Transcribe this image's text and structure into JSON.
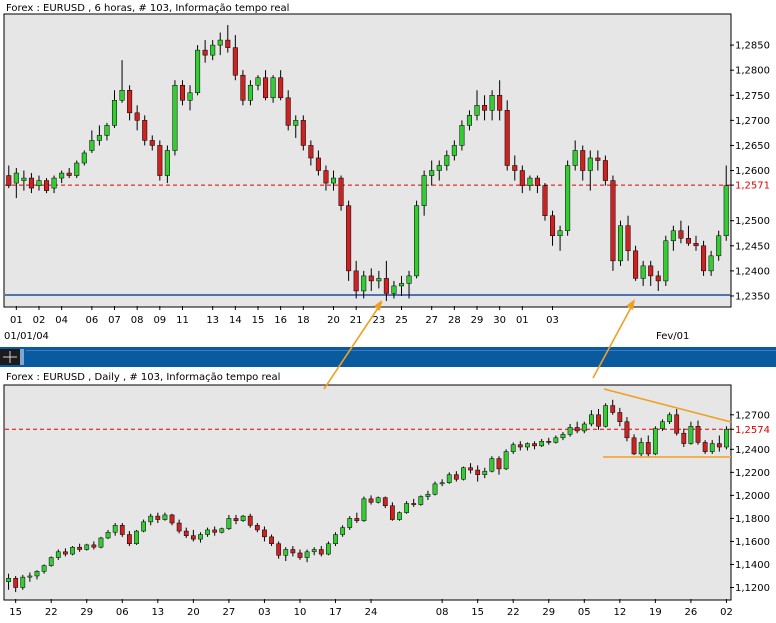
{
  "colors": {
    "panel_bg": "#e6e6e6",
    "up": "#33cc33",
    "down": "#cc2222",
    "wick": "#000000",
    "current_line": "#dd0000",
    "support_line": "#1f4e9e",
    "annotation": "#f0a020",
    "separator": "#0a5aa0"
  },
  "chart_data": [
    {
      "type": "candlestick",
      "title": "Forex : EURUSD , 6 horas, # 103, Informação tempo real",
      "y_ticks": [
        "1,2850",
        "1,2800",
        "1,2750",
        "1,2700",
        "1,2650",
        "1,2600",
        "1,2571",
        "1,2500",
        "1,2450",
        "1,2400",
        "1,2350"
      ],
      "current_price": 1.2571,
      "current_label": "1,2571",
      "ylim": [
        1.233,
        1.291
      ],
      "support_line": 1.2352,
      "x_ticks": [
        "01",
        "02",
        "04",
        "06",
        "07",
        "08",
        "09",
        "11",
        "13",
        "14",
        "15",
        "16",
        "18",
        "20",
        "21",
        "23",
        "25",
        "27",
        "28",
        "29",
        "30",
        "01",
        "03"
      ],
      "x_tick_positions": [
        1,
        4,
        7,
        11,
        14,
        17,
        20,
        23,
        27,
        30,
        33,
        36,
        39,
        43,
        46,
        49,
        52,
        56,
        59,
        62,
        65,
        68,
        72
      ],
      "x_date_left": "01/01/04",
      "x_date_right": "Fev/01",
      "candles": [
        [
          1.259,
          1.261,
          1.2565,
          1.257
        ],
        [
          1.2575,
          1.2605,
          1.2545,
          1.2595
        ],
        [
          1.258,
          1.26,
          1.256,
          1.2585
        ],
        [
          1.2585,
          1.2595,
          1.2555,
          1.2565
        ],
        [
          1.257,
          1.259,
          1.256,
          1.258
        ],
        [
          1.258,
          1.2585,
          1.2555,
          1.256
        ],
        [
          1.2565,
          1.259,
          1.2555,
          1.2585
        ],
        [
          1.2585,
          1.26,
          1.2575,
          1.2595
        ],
        [
          1.2595,
          1.2605,
          1.2585,
          1.259
        ],
        [
          1.259,
          1.262,
          1.2585,
          1.2615
        ],
        [
          1.2615,
          1.264,
          1.261,
          1.2635
        ],
        [
          1.264,
          1.268,
          1.2635,
          1.266
        ],
        [
          1.266,
          1.269,
          1.265,
          1.267
        ],
        [
          1.267,
          1.2695,
          1.266,
          1.269
        ],
        [
          1.269,
          1.276,
          1.2685,
          1.274
        ],
        [
          1.274,
          1.282,
          1.2735,
          1.276
        ],
        [
          1.276,
          1.277,
          1.27,
          1.2715
        ],
        [
          1.2715,
          1.273,
          1.268,
          1.27
        ],
        [
          1.27,
          1.271,
          1.265,
          1.266
        ],
        [
          1.266,
          1.267,
          1.264,
          1.265
        ],
        [
          1.265,
          1.266,
          1.258,
          1.259
        ],
        [
          1.259,
          1.265,
          1.2575,
          1.264
        ],
        [
          1.264,
          1.278,
          1.263,
          1.277
        ],
        [
          1.277,
          1.278,
          1.273,
          1.274
        ],
        [
          1.274,
          1.277,
          1.272,
          1.2755
        ],
        [
          1.2755,
          1.285,
          1.275,
          1.284
        ],
        [
          1.284,
          1.286,
          1.2815,
          1.283
        ],
        [
          1.283,
          1.286,
          1.282,
          1.285
        ],
        [
          1.285,
          1.2875,
          1.283,
          1.286
        ],
        [
          1.286,
          1.289,
          1.2835,
          1.2845
        ],
        [
          1.2845,
          1.287,
          1.278,
          1.279
        ],
        [
          1.279,
          1.28,
          1.273,
          1.274
        ],
        [
          1.274,
          1.278,
          1.273,
          1.277
        ],
        [
          1.277,
          1.279,
          1.276,
          1.2785
        ],
        [
          1.2785,
          1.28,
          1.274,
          1.2745
        ],
        [
          1.2745,
          1.279,
          1.2735,
          1.2785
        ],
        [
          1.2785,
          1.28,
          1.274,
          1.2745
        ],
        [
          1.2745,
          1.276,
          1.268,
          1.269
        ],
        [
          1.269,
          1.271,
          1.2665,
          1.27
        ],
        [
          1.27,
          1.271,
          1.264,
          1.265
        ],
        [
          1.265,
          1.266,
          1.261,
          1.2625
        ],
        [
          1.2625,
          1.264,
          1.259,
          1.26
        ],
        [
          1.26,
          1.261,
          1.256,
          1.2575
        ],
        [
          1.2575,
          1.26,
          1.256,
          1.2585
        ],
        [
          1.2585,
          1.259,
          1.252,
          1.253
        ],
        [
          1.253,
          1.254,
          1.238,
          1.24
        ],
        [
          1.24,
          1.242,
          1.2345,
          1.236
        ],
        [
          1.236,
          1.24,
          1.2345,
          1.239
        ],
        [
          1.239,
          1.2405,
          1.236,
          1.238
        ],
        [
          1.238,
          1.24,
          1.2365,
          1.2385
        ],
        [
          1.2385,
          1.242,
          1.234,
          1.2355
        ],
        [
          1.2355,
          1.238,
          1.2345,
          1.237
        ],
        [
          1.237,
          1.239,
          1.235,
          1.2375
        ],
        [
          1.2375,
          1.24,
          1.2345,
          1.239
        ],
        [
          1.239,
          1.254,
          1.2385,
          1.253
        ],
        [
          1.253,
          1.26,
          1.251,
          1.259
        ],
        [
          1.259,
          1.262,
          1.257,
          1.26
        ],
        [
          1.26,
          1.262,
          1.258,
          1.261
        ],
        [
          1.261,
          1.264,
          1.26,
          1.263
        ],
        [
          1.263,
          1.266,
          1.262,
          1.265
        ],
        [
          1.265,
          1.27,
          1.264,
          1.269
        ],
        [
          1.269,
          1.272,
          1.268,
          1.271
        ],
        [
          1.271,
          1.276,
          1.27,
          1.273
        ],
        [
          1.273,
          1.275,
          1.27,
          1.272
        ],
        [
          1.272,
          1.276,
          1.27,
          1.275
        ],
        [
          1.275,
          1.278,
          1.27,
          1.272
        ],
        [
          1.272,
          1.274,
          1.26,
          1.261
        ],
        [
          1.261,
          1.263,
          1.258,
          1.26
        ],
        [
          1.26,
          1.261,
          1.2555,
          1.257
        ],
        [
          1.257,
          1.259,
          1.256,
          1.2585
        ],
        [
          1.2585,
          1.259,
          1.2555,
          1.257
        ],
        [
          1.257,
          1.2575,
          1.25,
          1.251
        ],
        [
          1.251,
          1.252,
          1.245,
          1.247
        ],
        [
          1.247,
          1.249,
          1.244,
          1.248
        ],
        [
          1.248,
          1.262,
          1.247,
          1.261
        ],
        [
          1.261,
          1.266,
          1.26,
          1.264
        ],
        [
          1.264,
          1.265,
          1.258,
          1.26
        ],
        [
          1.26,
          1.264,
          1.256,
          1.2625
        ],
        [
          1.2625,
          1.264,
          1.26,
          1.262
        ],
        [
          1.262,
          1.263,
          1.257,
          1.258
        ],
        [
          1.258,
          1.259,
          1.24,
          1.242
        ],
        [
          1.242,
          1.25,
          1.241,
          1.249
        ],
        [
          1.249,
          1.251,
          1.242,
          1.244
        ],
        [
          1.244,
          1.245,
          1.238,
          1.2385
        ],
        [
          1.2385,
          1.242,
          1.237,
          1.241
        ],
        [
          1.241,
          1.242,
          1.237,
          1.239
        ],
        [
          1.239,
          1.24,
          1.236,
          1.238
        ],
        [
          1.238,
          1.247,
          1.237,
          1.246
        ],
        [
          1.246,
          1.249,
          1.244,
          1.248
        ],
        [
          1.248,
          1.25,
          1.2455,
          1.2465
        ],
        [
          1.2465,
          1.249,
          1.245,
          1.2455
        ],
        [
          1.2455,
          1.247,
          1.244,
          1.245
        ],
        [
          1.245,
          1.246,
          1.239,
          1.24
        ],
        [
          1.24,
          1.244,
          1.239,
          1.243
        ],
        [
          1.243,
          1.248,
          1.242,
          1.247
        ],
        [
          1.247,
          1.261,
          1.246,
          1.257
        ]
      ]
    },
    {
      "type": "candlestick",
      "title": "Forex : EURUSD , Daily , # 103, Informação tempo real",
      "y_ticks": [
        "1,2700",
        "1,2574",
        "1,2400",
        "1,2200",
        "1,2000",
        "1,1800",
        "1,1600",
        "1,1400",
        "1,1200"
      ],
      "current_price": 1.2574,
      "current_label": "1,2574",
      "ylim": [
        1.11,
        1.295
      ],
      "x_ticks": [
        "15",
        "22",
        "29",
        "06",
        "13",
        "20",
        "27",
        "03",
        "10",
        "17",
        "24",
        "08",
        "15",
        "22",
        "29",
        "05",
        "12",
        "19",
        "26",
        "02"
      ],
      "x_tick_positions": [
        1,
        6,
        11,
        16,
        21,
        26,
        31,
        36,
        41,
        46,
        51,
        61,
        66,
        71,
        76,
        81,
        86,
        91,
        96,
        101
      ],
      "candles": [
        [
          1.125,
          1.132,
          1.118,
          1.128
        ],
        [
          1.128,
          1.13,
          1.116,
          1.12
        ],
        [
          1.12,
          1.131,
          1.118,
          1.129
        ],
        [
          1.129,
          1.133,
          1.125,
          1.13
        ],
        [
          1.13,
          1.135,
          1.127,
          1.134
        ],
        [
          1.134,
          1.14,
          1.132,
          1.139
        ],
        [
          1.139,
          1.147,
          1.138,
          1.146
        ],
        [
          1.146,
          1.153,
          1.144,
          1.151
        ],
        [
          1.151,
          1.154,
          1.147,
          1.149
        ],
        [
          1.149,
          1.156,
          1.148,
          1.155
        ],
        [
          1.155,
          1.158,
          1.151,
          1.153
        ],
        [
          1.153,
          1.158,
          1.152,
          1.157
        ],
        [
          1.157,
          1.16,
          1.153,
          1.155
        ],
        [
          1.155,
          1.164,
          1.154,
          1.163
        ],
        [
          1.163,
          1.17,
          1.162,
          1.168
        ],
        [
          1.168,
          1.176,
          1.165,
          1.174
        ],
        [
          1.174,
          1.176,
          1.164,
          1.166
        ],
        [
          1.166,
          1.169,
          1.156,
          1.158
        ],
        [
          1.158,
          1.17,
          1.157,
          1.169
        ],
        [
          1.169,
          1.179,
          1.168,
          1.177
        ],
        [
          1.177,
          1.184,
          1.174,
          1.182
        ],
        [
          1.182,
          1.185,
          1.176,
          1.179
        ],
        [
          1.179,
          1.185,
          1.178,
          1.183
        ],
        [
          1.183,
          1.184,
          1.174,
          1.176
        ],
        [
          1.176,
          1.179,
          1.167,
          1.169
        ],
        [
          1.169,
          1.172,
          1.163,
          1.165
        ],
        [
          1.165,
          1.17,
          1.16,
          1.162
        ],
        [
          1.162,
          1.168,
          1.159,
          1.166
        ],
        [
          1.166,
          1.172,
          1.164,
          1.17
        ],
        [
          1.17,
          1.173,
          1.165,
          1.168
        ],
        [
          1.168,
          1.172,
          1.167,
          1.171
        ],
        [
          1.171,
          1.183,
          1.17,
          1.18
        ],
        [
          1.18,
          1.183,
          1.175,
          1.178
        ],
        [
          1.178,
          1.183,
          1.177,
          1.182
        ],
        [
          1.182,
          1.184,
          1.172,
          1.174
        ],
        [
          1.174,
          1.176,
          1.168,
          1.17
        ],
        [
          1.17,
          1.173,
          1.16,
          1.164
        ],
        [
          1.164,
          1.166,
          1.156,
          1.158
        ],
        [
          1.158,
          1.16,
          1.145,
          1.148
        ],
        [
          1.148,
          1.155,
          1.143,
          1.153
        ],
        [
          1.153,
          1.156,
          1.147,
          1.15
        ],
        [
          1.15,
          1.153,
          1.144,
          1.146
        ],
        [
          1.146,
          1.153,
          1.142,
          1.151
        ],
        [
          1.151,
          1.155,
          1.148,
          1.153
        ],
        [
          1.153,
          1.156,
          1.147,
          1.149
        ],
        [
          1.149,
          1.16,
          1.148,
          1.158
        ],
        [
          1.158,
          1.168,
          1.156,
          1.166
        ],
        [
          1.166,
          1.174,
          1.164,
          1.172
        ],
        [
          1.172,
          1.182,
          1.17,
          1.18
        ],
        [
          1.18,
          1.185,
          1.176,
          1.178
        ],
        [
          1.178,
          1.199,
          1.177,
          1.197
        ],
        [
          1.197,
          1.2,
          1.192,
          1.194
        ],
        [
          1.194,
          1.199,
          1.193,
          1.198
        ],
        [
          1.198,
          1.199,
          1.189,
          1.191
        ],
        [
          1.191,
          1.194,
          1.178,
          1.179
        ],
        [
          1.179,
          1.186,
          1.178,
          1.185
        ],
        [
          1.185,
          1.195,
          1.184,
          1.193
        ],
        [
          1.193,
          1.197,
          1.19,
          1.192
        ],
        [
          1.192,
          1.2,
          1.191,
          1.199
        ],
        [
          1.199,
          1.204,
          1.196,
          1.201
        ],
        [
          1.201,
          1.212,
          1.2,
          1.21
        ],
        [
          1.21,
          1.214,
          1.208,
          1.211
        ],
        [
          1.211,
          1.22,
          1.21,
          1.218
        ],
        [
          1.218,
          1.221,
          1.212,
          1.214
        ],
        [
          1.214,
          1.225,
          1.213,
          1.224
        ],
        [
          1.224,
          1.228,
          1.219,
          1.222
        ],
        [
          1.222,
          1.226,
          1.212,
          1.218
        ],
        [
          1.218,
          1.224,
          1.215,
          1.221
        ],
        [
          1.221,
          1.234,
          1.22,
          1.232
        ],
        [
          1.232,
          1.234,
          1.218,
          1.223
        ],
        [
          1.223,
          1.24,
          1.222,
          1.238
        ],
        [
          1.238,
          1.246,
          1.236,
          1.244
        ],
        [
          1.244,
          1.247,
          1.239,
          1.242
        ],
        [
          1.242,
          1.246,
          1.239,
          1.245
        ],
        [
          1.245,
          1.247,
          1.24,
          1.243
        ],
        [
          1.243,
          1.249,
          1.242,
          1.247
        ],
        [
          1.247,
          1.25,
          1.244,
          1.246
        ],
        [
          1.246,
          1.252,
          1.245,
          1.25
        ],
        [
          1.25,
          1.255,
          1.248,
          1.253
        ],
        [
          1.253,
          1.262,
          1.251,
          1.259
        ],
        [
          1.259,
          1.264,
          1.254,
          1.256
        ],
        [
          1.256,
          1.264,
          1.254,
          1.262
        ],
        [
          1.262,
          1.274,
          1.26,
          1.27
        ],
        [
          1.27,
          1.275,
          1.257,
          1.26
        ],
        [
          1.26,
          1.28,
          1.259,
          1.278
        ],
        [
          1.278,
          1.283,
          1.27,
          1.272
        ],
        [
          1.272,
          1.276,
          1.26,
          1.264
        ],
        [
          1.264,
          1.268,
          1.247,
          1.25
        ],
        [
          1.25,
          1.253,
          1.235,
          1.236
        ],
        [
          1.236,
          1.25,
          1.234,
          1.246
        ],
        [
          1.246,
          1.252,
          1.234,
          1.236
        ],
        [
          1.236,
          1.26,
          1.235,
          1.258
        ],
        [
          1.258,
          1.266,
          1.256,
          1.264
        ],
        [
          1.264,
          1.272,
          1.262,
          1.27
        ],
        [
          1.27,
          1.275,
          1.252,
          1.254
        ],
        [
          1.254,
          1.258,
          1.242,
          1.245
        ],
        [
          1.245,
          1.264,
          1.244,
          1.26
        ],
        [
          1.26,
          1.265,
          1.244,
          1.246
        ],
        [
          1.246,
          1.248,
          1.236,
          1.238
        ],
        [
          1.238,
          1.248,
          1.236,
          1.245
        ],
        [
          1.245,
          1.252,
          1.238,
          1.242
        ],
        [
          1.242,
          1.26,
          1.24,
          1.2574
        ]
      ]
    }
  ]
}
